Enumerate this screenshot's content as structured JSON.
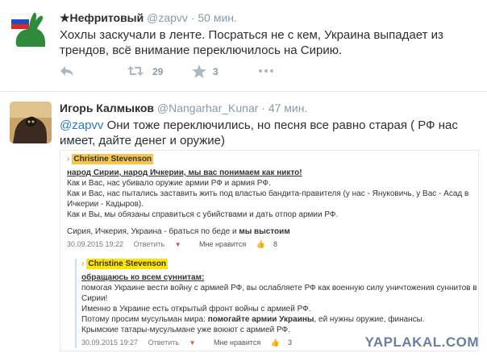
{
  "tweets": [
    {
      "name": "★Нефритовый",
      "handle": "@zapvv",
      "time": "· 50 мин.",
      "text": "Хохлы заскучали в ленте. Посраться не с кем, Украина выпадает из трендов, всё внимание переключилось на Сирию.",
      "retweets": "29",
      "favorites": "3"
    },
    {
      "name": "Игорь Калмыков",
      "handle": "@Nangarhar_Kunar",
      "time": "· 47 мин.",
      "mention": "@zapvv",
      "text": " Они тоже переключились, но песня все равно старая ( РФ нас имеет, дайте денег и оружие)"
    }
  ],
  "screenshot": {
    "c1": {
      "author": "Christine Stevenson",
      "headline": "народ Сирии, народ Ичкерии, мы вас понимаем как никто!",
      "lines": [
        "Как и Вас, нас убивало оружие армии РФ и армия РФ.",
        "Как и Вас, нас пытались заставить жить под властью бандита-правителя (у нас - Януковичь, у Вас - Асад в Ичкерии - Кадыров).",
        "Как и Вы, мы обязаны справиться с убийствами и дать отпор армии РФ."
      ],
      "closing_plain": "Сирия, Ичкерия, Украина - браться по беде и ",
      "closing_bold": "мы выстоим",
      "date": "30.09.2015 19:22",
      "reply": "Ответить",
      "like": "Мне нравится",
      "likes": "8"
    },
    "c2": {
      "author": "Christine Stevenson",
      "headline": "обращаюсь ко всем суннитам:",
      "line1": "помогая Украине вести войну с армией РФ, вы ослабляете РФ как военную силу уничтожения суннитов в Сирии!",
      "line2": "Именно в Украине есть открытый фронт войны с армией РФ.",
      "line3_plain": "Потому просим мусульман мира: ",
      "line3_bold": "помогайте армии Украины",
      "line3_tail": ", ей нужны оружие, финансы.",
      "line4": "Крымские татары-мусульмане уже воюют с армией РФ.",
      "date": "30.09.2015 19:27",
      "reply": "Ответить",
      "like": "Мне нравится",
      "likes": "3"
    },
    "watermark": "YAPLAKAL.COM"
  },
  "icons": {
    "reply": "reply-icon",
    "retweet": "retweet-icon",
    "favorite": "star-icon",
    "more": "more-icon"
  }
}
